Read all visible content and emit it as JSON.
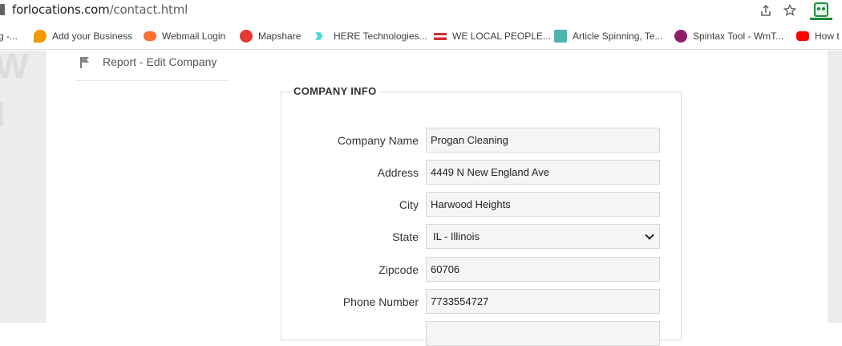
{
  "browser": {
    "url_host": "forlocations.com",
    "url_path": "/contact.html",
    "icons": [
      "share-icon",
      "star-icon",
      "extension-icon"
    ]
  },
  "bookmarks": [
    {
      "label": "g -...",
      "icon": "bookmark-icon",
      "color": "#888888"
    },
    {
      "label": "Add your Business",
      "icon": "add-business-icon",
      "color": "#f29900"
    },
    {
      "label": "Webmail Login",
      "icon": "cpanel-icon",
      "color": "#ff6c2c"
    },
    {
      "label": "Mapshare",
      "icon": "mapshare-icon",
      "color": "#e53935"
    },
    {
      "label": "HERE Technologies...",
      "icon": "here-icon",
      "color": "#48dad0"
    },
    {
      "label": "WE LOCAL PEOPLE...",
      "icon": "welocal-icon",
      "color": "#d32f2f"
    },
    {
      "label": "Article Spinning, Te...",
      "icon": "article-icon",
      "color": "#4db6ac"
    },
    {
      "label": "Spintax Tool - WmT...",
      "icon": "spintax-icon",
      "color": "#8e1f6b"
    },
    {
      "label": "How t",
      "icon": "youtube-icon",
      "color": "#ff0000"
    }
  ],
  "sidebar": {
    "item": {
      "label": "Report - Edit Company",
      "icon": "flag-icon"
    }
  },
  "company_info": {
    "legend": "COMPANY INFO",
    "fields": [
      {
        "label": "Company Name",
        "value": "Progan Cleaning"
      },
      {
        "label": "Address",
        "value": "4449 N New England Ave"
      },
      {
        "label": "City",
        "value": "Harwood Heights"
      },
      {
        "label": "State",
        "value": "IL - Illinois"
      },
      {
        "label": "Zipcode",
        "value": "60706"
      },
      {
        "label": "Phone Number",
        "value": "7733554727"
      }
    ]
  }
}
